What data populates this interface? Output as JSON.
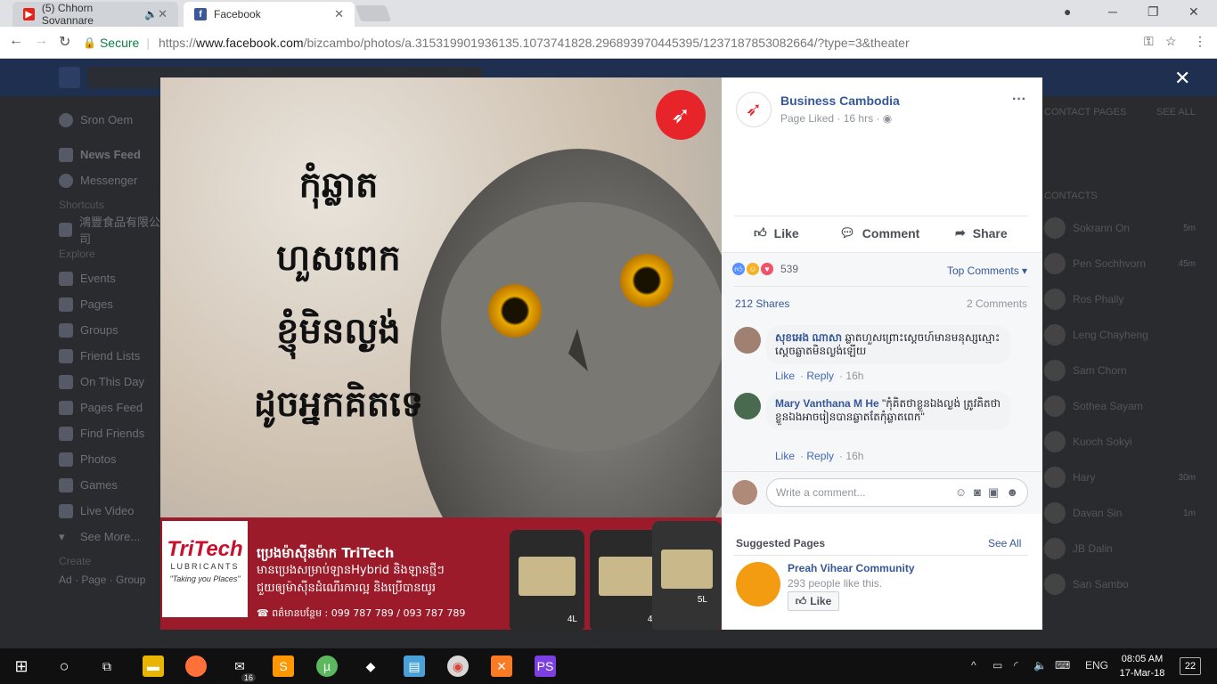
{
  "browser": {
    "tabs": [
      {
        "title": "(5) Chhorn Sovannare",
        "icon": "youtube-icon",
        "active": false
      },
      {
        "title": "Facebook",
        "icon": "facebook-icon",
        "active": true
      }
    ],
    "secure_label": "Secure",
    "url_prefix": "https://",
    "url_host": "www.facebook.com",
    "url_path": "/bizcambo/photos/a.315319901936135.1073741828.296893970445395/1237187853082664/?type=3&theater"
  },
  "left_nav": {
    "profile": "Sron Oem",
    "items": [
      "News Feed",
      "Messenger"
    ],
    "shortcuts_header": "Shortcuts",
    "shortcut_item": "鴻豐食品有限公司",
    "explore_header": "Explore",
    "explore_items": [
      "Events",
      "Pages",
      "Groups",
      "Friend Lists",
      "On This Day",
      "Pages Feed",
      "Find Friends",
      "Photos",
      "Games",
      "Live Video",
      "See More..."
    ],
    "create_header": "Create",
    "create_items": "Ad · Page · Group"
  },
  "right_nav": {
    "contact_pages": "CONTACT PAGES",
    "see_all": "SEE ALL",
    "contacts_header": "CONTACTS",
    "contacts": [
      {
        "name": "Sokrann On",
        "time": "5m"
      },
      {
        "name": "Pen Sochhvorn",
        "time": "45m"
      },
      {
        "name": "Ros Phally",
        "time": ""
      },
      {
        "name": "Leng Chayheng",
        "time": ""
      },
      {
        "name": "Sam Chorn",
        "time": ""
      },
      {
        "name": "Sothea Sayam",
        "time": ""
      },
      {
        "name": "Kuoch Sokyi",
        "time": ""
      },
      {
        "name": "Hary",
        "time": "30m"
      },
      {
        "name": "Davan Sin",
        "time": "1m"
      },
      {
        "name": "JB Dalin",
        "time": ""
      },
      {
        "name": "San Sambo",
        "time": ""
      }
    ]
  },
  "photo": {
    "headline": [
      "កុំឆ្លាត",
      "ហួសពេក",
      "ខ្ញុំមិនល្ងង់",
      "ដូចអ្នកគិតទេ"
    ],
    "brand_logo": "TriTech",
    "brand_sub": "LUBRICANTS",
    "brand_tag": "\"Taking you Places\"",
    "ad_title": "ប្រេងម៉ាស៊ីនម៉ាក TriTech",
    "ad_line1": "មានប្រេងសម្រាប់ឡានHybrid និងឡានថ្មីៗ",
    "ad_line2": "ជួយឲ្យម៉ាស៊ីនដំណើរការល្អ និងប្រើបានយូរ",
    "ad_phone": "ពត៌មានបន្ថែម : 099 787 789 / 093 787 789",
    "bottle_sizes": [
      "4L",
      "4L",
      "5L"
    ]
  },
  "panel": {
    "page_name": "Business Cambodia",
    "meta": "Page Liked · 16 hrs · ",
    "actions": {
      "like": "Like",
      "comment": "Comment",
      "share": "Share"
    },
    "reactions_count": "539",
    "top_comments": "Top Comments ▾",
    "shares": "212 Shares",
    "comments_count": "2 Comments",
    "comments": [
      {
        "author": "សុខអេង ណាសា",
        "text": "ឆ្លាតហួសព្រោះស្ដេចហ៍មានមនុស្សស្មោះស្ដេចឆ្លាតមិនល្ងង់ឡើយ",
        "like": "Like",
        "reply": "Reply",
        "time": "16h"
      },
      {
        "author": "Mary Vanthana M He",
        "text": "\"កុំគិតថាខ្លួនឯងល្ងង់ ត្រូវគិតថាខ្លួនឯងអាចរៀនបានឆ្លាតតែកុំឆ្លាតពេក\"",
        "like": "Like",
        "reply": "Reply",
        "time": "16h"
      }
    ],
    "write_placeholder": "Write a comment...",
    "suggested_header": "Suggested Pages",
    "suggested_see_all": "See All",
    "suggested_name": "Preah Vihear Community",
    "suggested_likes": "293 people like this.",
    "suggested_like_btn": "Like"
  },
  "taskbar": {
    "lang": "ENG",
    "time": "08:05 AM",
    "date": "17-Mar-18",
    "notif": "22",
    "mail_badge": "16"
  }
}
